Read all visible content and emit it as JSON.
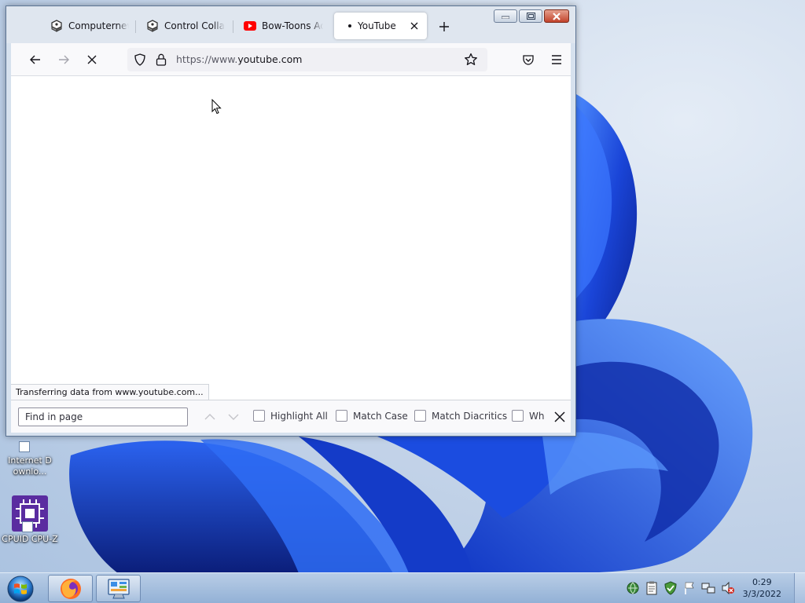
{
  "desktop": {
    "icons": [
      {
        "label": "Internet Downlo...",
        "icon": "internet-download-manager-icon"
      },
      {
        "label": "CPUID CPU-Z",
        "icon": "cpu-z-icon"
      }
    ]
  },
  "browser": {
    "tabs": [
      {
        "title": "Computernewb",
        "icon": "computernewb-icon",
        "active": false
      },
      {
        "title": "Control Collaborate",
        "icon": "computernewb-icon",
        "active": false
      },
      {
        "title": "Bow-Toons Adventures",
        "icon": "youtube-icon",
        "active": false
      },
      {
        "title": "YouTube",
        "icon": "loading-dot",
        "active": true
      }
    ],
    "url": {
      "prefix": "https://www.",
      "domain": "youtube.com"
    },
    "status_text": "Transferring data from www.youtube.com...",
    "findbar": {
      "placeholder": "Find in page",
      "highlight_all": "Highlight All",
      "match_case": "Match Case",
      "match_diacritics": "Match Diacritics",
      "whole_words": "Wh"
    }
  },
  "taskbar": {
    "clock": {
      "time": "0:29",
      "date": "3/3/2022"
    }
  },
  "colors": {
    "wallpaper_blue": "#1f4fe0",
    "firefox_orange": "#ff6b22",
    "youtube_red": "#ff0000"
  }
}
